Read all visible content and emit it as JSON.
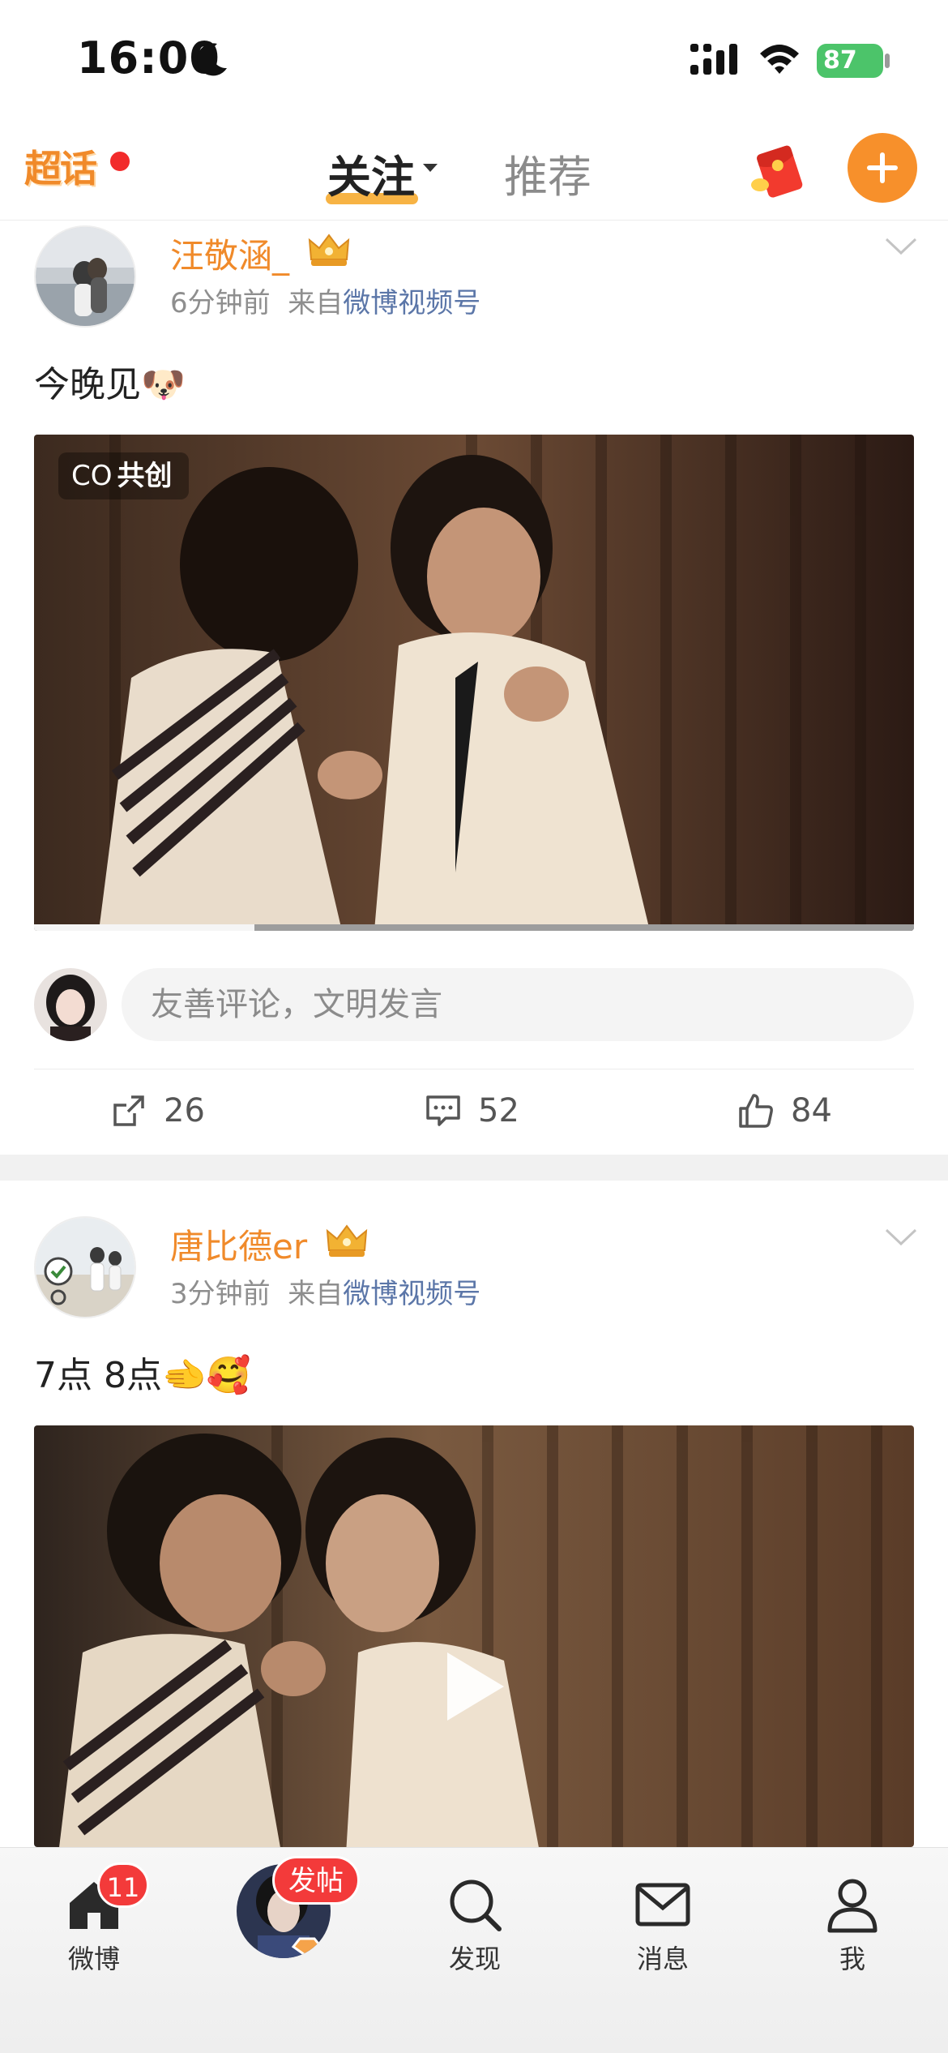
{
  "status_bar": {
    "time": "16:00",
    "battery": "87"
  },
  "top_nav": {
    "logo": "超话",
    "tab_follow": "关注",
    "tab_recommend": "推荐"
  },
  "posts": [
    {
      "username": "汪敬涵_",
      "time_ago": "6分钟前",
      "from_prefix": "来自",
      "source": "微博视频号",
      "text": "今晚见🐶",
      "video_badge_icon": "CO",
      "video_badge": "共创",
      "progress": 0.25,
      "comment_placeholder": "友善评论，文明发言",
      "reposts": "26",
      "comments": "52",
      "likes": "84"
    },
    {
      "username": "唐比德er",
      "time_ago": "3分钟前",
      "from_prefix": "来自",
      "source": "微博视频号",
      "text": "7点 8点🫲🥰"
    }
  ],
  "tab_bar": {
    "home_label": "微博",
    "home_badge": "11",
    "post_badge": "发帖",
    "discover_label": "发现",
    "messages_label": "消息",
    "me_label": "我"
  },
  "colors": {
    "accent": "#f7902b",
    "username": "#f08a2a",
    "badge_red": "#f33a3a"
  }
}
